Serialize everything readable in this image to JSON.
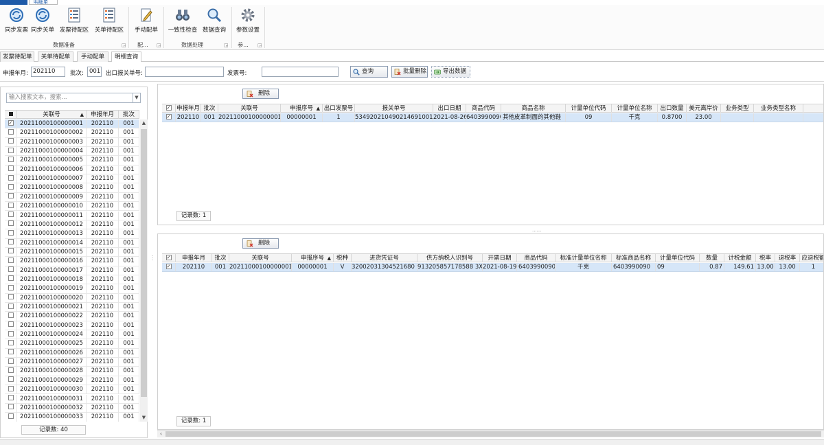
{
  "ribbon_tabs": {
    "app_tab": "",
    "active_tab": "明细单"
  },
  "ribbon": {
    "buttons": [
      {
        "label": "同步发票",
        "icon": "sync-icon"
      },
      {
        "label": "同步关单",
        "icon": "sync-icon"
      },
      {
        "label": "发票待配区",
        "icon": "list-icon"
      },
      {
        "label": "关单待配区",
        "icon": "list-icon"
      },
      {
        "label": "手动配单",
        "icon": "pencil-doc-icon"
      },
      {
        "label": "一致性检查",
        "icon": "binoculars-icon"
      },
      {
        "label": "数据查询",
        "icon": "magnifier-icon"
      },
      {
        "label": "参数设置",
        "icon": "gear-icon"
      }
    ],
    "groups": [
      "数据准备",
      "配...",
      "数据处理",
      "参..."
    ]
  },
  "subtabs": [
    "发票待配单",
    "关单待配单",
    "手动配单",
    "明细查询"
  ],
  "filter": {
    "period_label": "申报年月:",
    "period_value": "202110",
    "batch_label": "批次:",
    "batch_value": "001",
    "customs_no_label": "出口报关单号:",
    "customs_no_value": "",
    "invoice_no_label": "发票号:",
    "invoice_no_value": "",
    "query_button": "查询",
    "batch_delete_button": "批量删除",
    "export_button": "导出数据"
  },
  "left_panel": {
    "search_placeholder": "输入搜索文本，搜索...",
    "columns": [
      "关联号",
      "申报年月",
      "批次"
    ],
    "rows": [
      [
        "20211000100000001",
        "202110",
        "001"
      ],
      [
        "20211000100000002",
        "202110",
        "001"
      ],
      [
        "20211000100000003",
        "202110",
        "001"
      ],
      [
        "20211000100000004",
        "202110",
        "001"
      ],
      [
        "20211000100000005",
        "202110",
        "001"
      ],
      [
        "20211000100000006",
        "202110",
        "001"
      ],
      [
        "20211000100000007",
        "202110",
        "001"
      ],
      [
        "20211000100000008",
        "202110",
        "001"
      ],
      [
        "20211000100000009",
        "202110",
        "001"
      ],
      [
        "20211000100000010",
        "202110",
        "001"
      ],
      [
        "20211000100000011",
        "202110",
        "001"
      ],
      [
        "20211000100000012",
        "202110",
        "001"
      ],
      [
        "20211000100000013",
        "202110",
        "001"
      ],
      [
        "20211000100000014",
        "202110",
        "001"
      ],
      [
        "20211000100000015",
        "202110",
        "001"
      ],
      [
        "20211000100000016",
        "202110",
        "001"
      ],
      [
        "20211000100000017",
        "202110",
        "001"
      ],
      [
        "20211000100000018",
        "202110",
        "001"
      ],
      [
        "20211000100000019",
        "202110",
        "001"
      ],
      [
        "20211000100000020",
        "202110",
        "001"
      ],
      [
        "20211000100000021",
        "202110",
        "001"
      ],
      [
        "20211000100000022",
        "202110",
        "001"
      ],
      [
        "20211000100000023",
        "202110",
        "001"
      ],
      [
        "20211000100000024",
        "202110",
        "001"
      ],
      [
        "20211000100000025",
        "202110",
        "001"
      ],
      [
        "20211000100000026",
        "202110",
        "001"
      ],
      [
        "20211000100000027",
        "202110",
        "001"
      ],
      [
        "20211000100000028",
        "202110",
        "001"
      ],
      [
        "20211000100000029",
        "202110",
        "001"
      ],
      [
        "20211000100000030",
        "202110",
        "001"
      ],
      [
        "20211000100000031",
        "202110",
        "001"
      ],
      [
        "20211000100000032",
        "202110",
        "001"
      ],
      [
        "20211000100000033",
        "202110",
        "001"
      ]
    ],
    "checked_row": 0,
    "record_count": "记录数: 40"
  },
  "customs_panel": {
    "delete_button": "删除",
    "columns": [
      "申报年月",
      "批次",
      "关联号",
      "申报序号",
      "出口发票号",
      "报关单号",
      "出口日期",
      "商品代码",
      "商品名称",
      "计量单位代码",
      "计量单位名称",
      "出口数量",
      "美元离岸价",
      "业务类型",
      "业务类型名称"
    ],
    "rows": [
      [
        "202110",
        "001",
        "20211000100000001",
        "00000001",
        "1",
        "534920210490214691001",
        "2021-08-26",
        "6403990090",
        "其他皮革制面的其他鞋",
        "09",
        "千克",
        "0.8700",
        "23.00",
        "",
        ""
      ]
    ],
    "record_count": "记录数: 1"
  },
  "invoice_panel": {
    "delete_button": "删除",
    "columns": [
      "申报年月",
      "批次",
      "关联号",
      "申报序号",
      "税种",
      "进货凭证号",
      "供方纳税人识别号",
      "开票日期",
      "商品代码",
      "标准计量单位名称",
      "标准商品名称",
      "计量单位代码",
      "数量",
      "计税金额",
      "税率",
      "退税率",
      "应退税额"
    ],
    "rows": [
      [
        "202110",
        "001",
        "20211000100000001",
        "00000001",
        "V",
        "32002031304521680 7",
        "913205857178588 3XA",
        "2021-08-19",
        "6403990090",
        "千克",
        "6403990090",
        "09",
        "0.87",
        "149.61",
        "13.00",
        "13.00",
        "1"
      ]
    ],
    "record_count": "记录数: 1"
  }
}
